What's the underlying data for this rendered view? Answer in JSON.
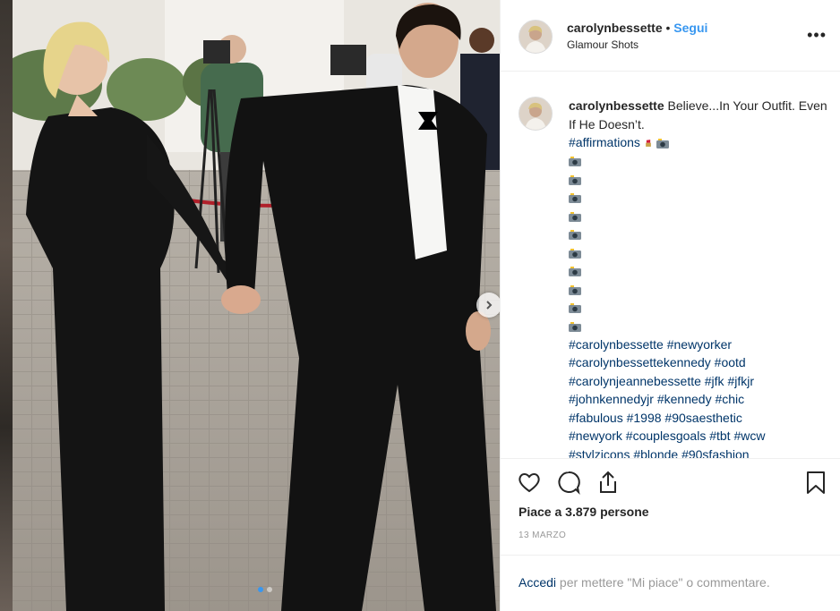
{
  "header": {
    "username": "carolynbessette",
    "separator": " • ",
    "follow_label": "Segui",
    "location": "Glamour Shots",
    "more_label": "•••"
  },
  "caption": {
    "username": "carolynbessette",
    "text": "Believe...In Your Outfit. Even If He Doesn’t.",
    "first_hashtag": "#affirmations",
    "emoji_repeat_count_label": "",
    "hashtag_lines": [
      "#carolynbessette #newyorker",
      "#carolynbessettekennedy #ootd",
      "#carolynjeannebessette #jfk #jfkjr",
      "#johnkennedyjr #kennedy #chic",
      "#fabulous #1998 #90saesthetic",
      "#newyork #couplesgoals #tbt #wcw",
      "#stylzicons #blonde #90sfashion"
    ]
  },
  "actions": {
    "likes_text": "Piace a 3.879 persone",
    "date_text": "13 MARZO"
  },
  "login": {
    "link_label": "Accedi",
    "rest_text": " per mettere \"Mi piace\" o commentare."
  },
  "colors": {
    "accent_blue": "#3897f0",
    "hashtag_blue": "#003569",
    "text_dark": "#262626",
    "text_muted": "#999999"
  },
  "icons": {
    "more": "more-horizontal-icon",
    "like": "heart-icon",
    "comment": "comment-bubble-icon",
    "share": "share-upload-icon",
    "save": "bookmark-icon",
    "next": "chevron-right-icon"
  }
}
